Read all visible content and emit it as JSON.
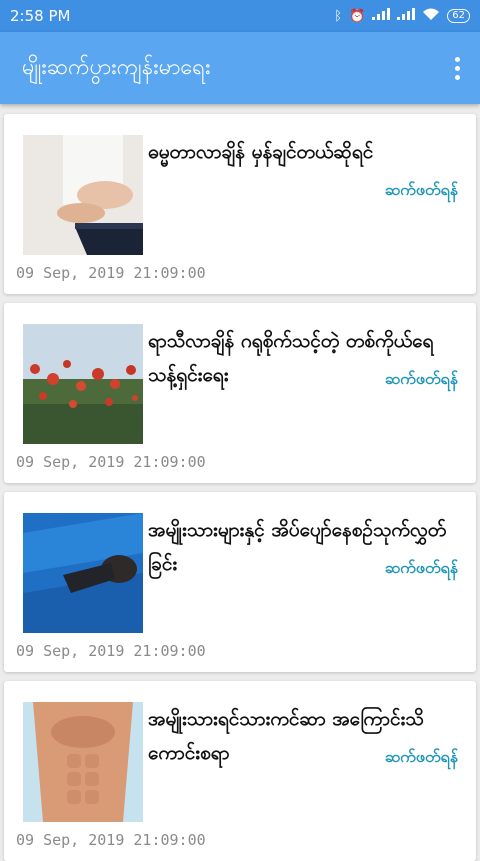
{
  "status_bar": {
    "time": "2:58 PM",
    "icons": [
      "bluetooth-icon",
      "alarm-icon",
      "signal-icon",
      "signal-icon",
      "wifi-icon"
    ],
    "battery": "62"
  },
  "app_bar": {
    "title": "မျိုးဆက်ပွားကျန်းမာရေး",
    "menu_icon": "more-vert-icon"
  },
  "articles": [
    {
      "title": "ဓမ္မတာလာချိန် မှန်ချင်တယ်ဆိုရင်",
      "read_more": "ဆက်ဖတ်ရန်",
      "date": "09 Sep, 2019 21:09:00",
      "image": "woman-holding-stomach"
    },
    {
      "title": "ရာသီလာချိန် ဂရုစိုက်သင့်တဲ့ တစ်ကိုယ်ရေသန့်ရှင်းရေး",
      "read_more": "ဆက်ဖတ်ရန်",
      "date": "09 Sep, 2019 21:09:00",
      "image": "red-poppy-field"
    },
    {
      "title": "အမျိုးသားများနှင့် အိပ်ပျော်နေစဉ်သုက်လွှတ်ခြင်း",
      "read_more": "ဆက်ဖတ်ရန်",
      "date": "09 Sep, 2019 21:09:00",
      "image": "man-sleeping-blue-sheets"
    },
    {
      "title": "အမျိုးသားရင်သားကင်ဆာ အကြောင်းသိကောင်းစရာ",
      "read_more": "ဆက်ဖတ်ရန်",
      "date": "09 Sep, 2019 21:09:00",
      "image": "male-torso"
    }
  ]
}
